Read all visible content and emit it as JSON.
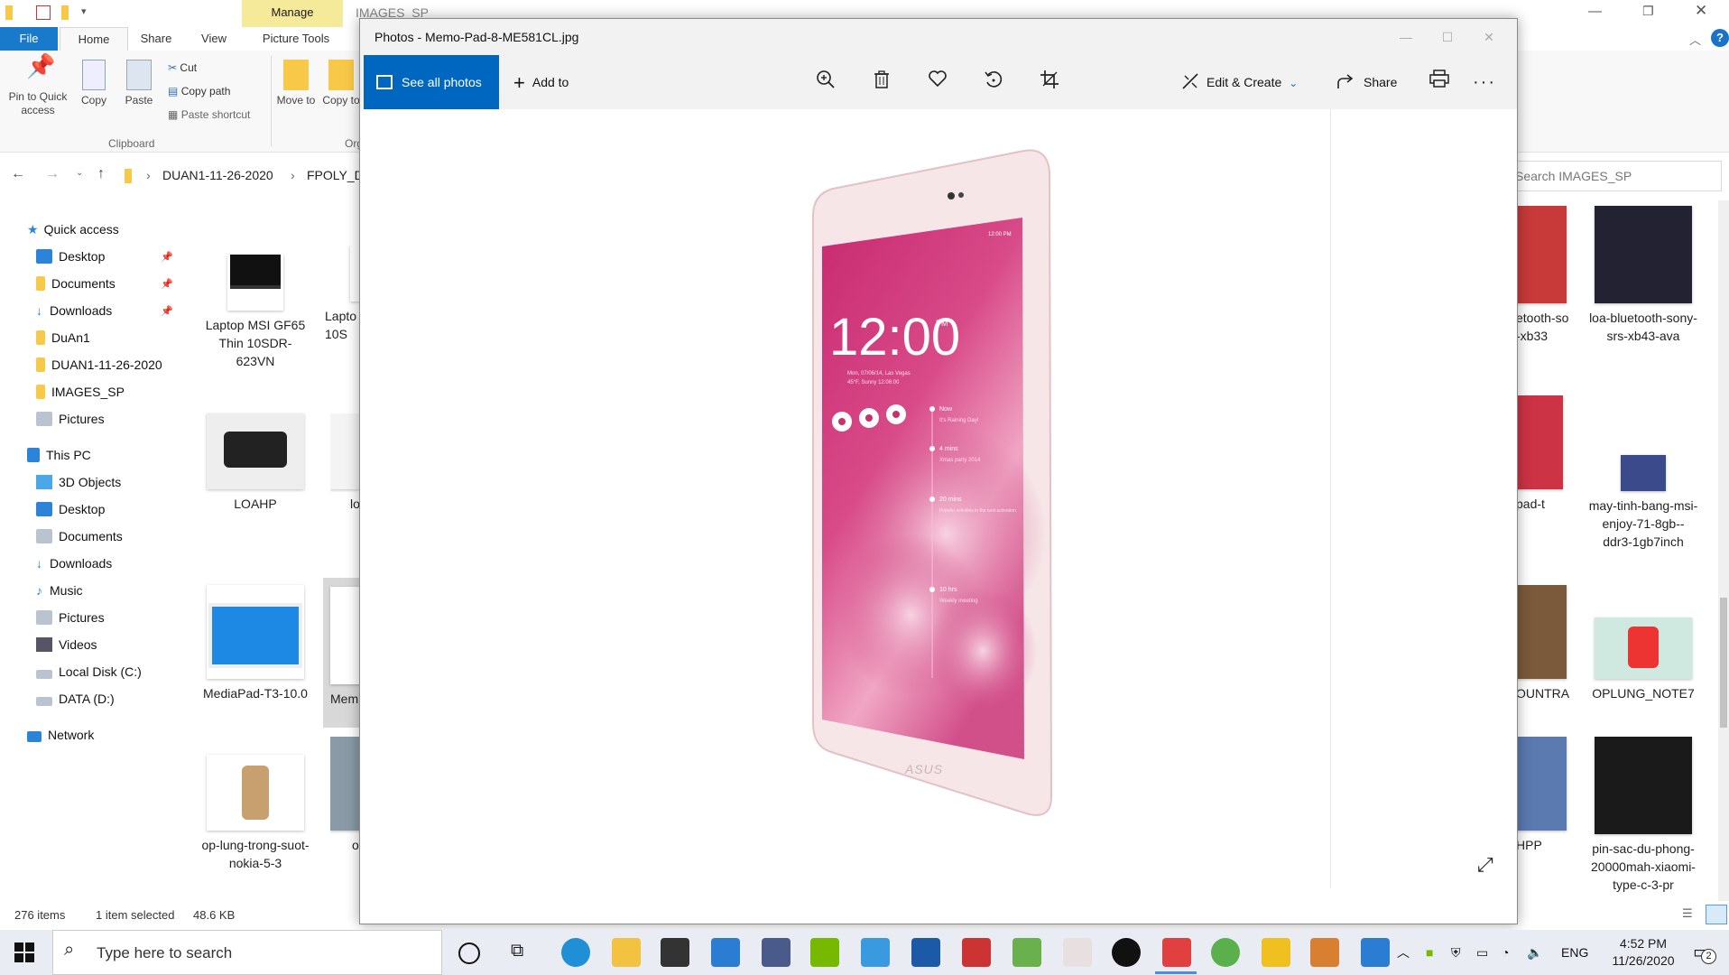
{
  "explorer": {
    "window_title": "IMAGES_SP",
    "contextual_tab": "Manage",
    "tabs": [
      "File",
      "Home",
      "Share",
      "View",
      "Picture Tools"
    ],
    "ribbon": {
      "pin_label": "Pin to Quick access",
      "copy_label": "Copy",
      "paste_label": "Paste",
      "cut_label": "Cut",
      "copy_path_label": "Copy path",
      "paste_shortcut_label": "Paste shortcut",
      "move_to_label": "Move to",
      "copy_to_label": "Copy to",
      "clipboard_group": "Clipboard",
      "organize_group_partial": "Org"
    },
    "breadcrumb": [
      "DUAN1-11-26-2020",
      "FPOLY_DA"
    ],
    "search_placeholder": "Search IMAGES_SP",
    "nav": {
      "quick_access": "Quick access",
      "quick_items": [
        {
          "label": "Desktop",
          "pinned": true
        },
        {
          "label": "Documents",
          "pinned": true
        },
        {
          "label": "Downloads",
          "pinned": true
        },
        {
          "label": "DuAn1",
          "pinned": false
        },
        {
          "label": "DUAN1-11-26-2020",
          "pinned": false
        },
        {
          "label": "IMAGES_SP",
          "pinned": false
        },
        {
          "label": "Pictures",
          "pinned": false
        }
      ],
      "this_pc": "This PC",
      "pc_items": [
        "3D Objects",
        "Desktop",
        "Documents",
        "Downloads",
        "Music",
        "Pictures",
        "Videos",
        "Local Disk (C:)",
        "DATA (D:)"
      ],
      "network": "Network"
    },
    "files_left": [
      {
        "name": "Laptop MSI GF65 Thin 10SDR-623VN"
      },
      {
        "name": "Lapto 10S"
      },
      {
        "name": "LOAHP"
      },
      {
        "name": "lo"
      },
      {
        "name": "MediaPad-T3-10.0"
      },
      {
        "name": "Mem"
      },
      {
        "name": "op-lung-trong-suot-nokia-5-3"
      },
      {
        "name": "o"
      }
    ],
    "files_right": [
      {
        "name": "etooth-so -xb33"
      },
      {
        "name": "loa-bluetooth-sony-srs-xb43-ava"
      },
      {
        "name": "pad-t"
      },
      {
        "name": "may-tinh-bang-msi-enjoy-71-8gb--ddr3-1gb7inch"
      },
      {
        "name": "OUNTRAL"
      },
      {
        "name": "OPLUNG_NOTE7"
      },
      {
        "name": "HPP"
      },
      {
        "name": "pin-sac-du-phong-20000mah-xiaomi-type-c-3-pr"
      }
    ],
    "status": {
      "count": "276 items",
      "selected": "1 item selected",
      "size": "48.6 KB"
    }
  },
  "photos": {
    "title": "Photos - Memo-Pad-8-ME581CL.jpg",
    "see_all": "See all photos",
    "add_to": "Add to",
    "edit_create": "Edit & Create",
    "share": "Share",
    "icons": [
      "zoom-icon",
      "delete-icon",
      "heart-icon",
      "rotate-icon",
      "crop-icon",
      "print-icon",
      "more-icon"
    ],
    "tablet": {
      "time": "12:00",
      "ampm": "PM",
      "date_line": "Mon, 07/06/14, Las Vegas",
      "weather": "45°F, Sunny 12:06:00",
      "status_time": "12:00 PM",
      "brand": "ASUS",
      "agenda": [
        {
          "when": "Now",
          "what": "It's Raining Day!"
        },
        {
          "when": "4 mins",
          "what": "Xmas party 2014"
        },
        {
          "when": "20 mins",
          "what": "Popular activities in the next activation"
        },
        {
          "when": "10 hrs",
          "what": "Weekly meeting"
        }
      ]
    }
  },
  "taskbar": {
    "search_placeholder": "Type here to search",
    "lang": "ENG",
    "time": "4:52 PM",
    "date": "11/26/2020",
    "notification_count": "2"
  }
}
